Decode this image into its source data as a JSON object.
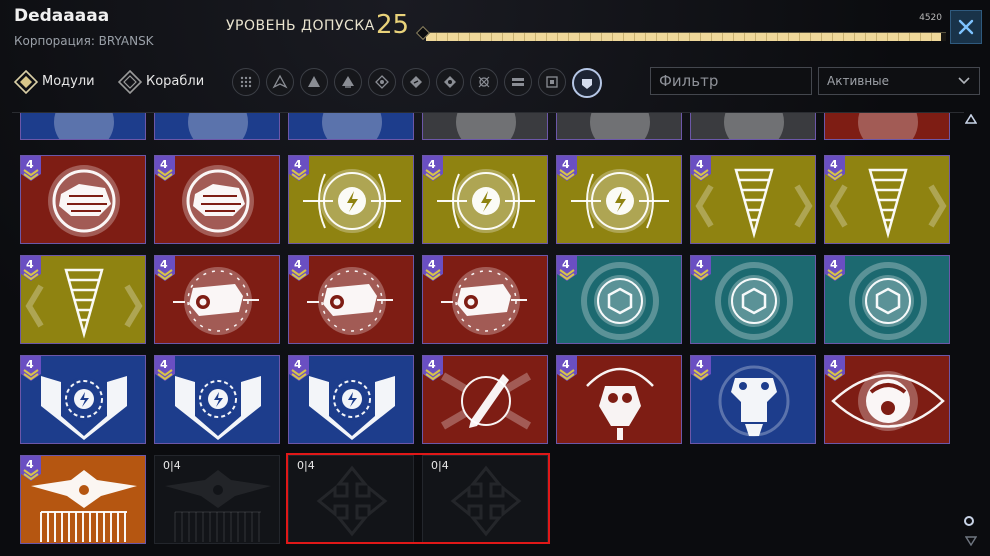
{
  "header": {
    "player_name": "Dedaaaaa",
    "corporation": "Корпорация: BRYANSK",
    "access_label": "УРОВЕНЬ ДОПУСКА",
    "access_level": "25",
    "progress_max": "4520",
    "progress_fraction": 0.99
  },
  "toolbar": {
    "tabs": [
      {
        "label": "Модули",
        "icon": "modules-diamond-icon",
        "active": true
      },
      {
        "label": "Корабли",
        "icon": "ships-diamond-icon",
        "active": false
      }
    ],
    "filter_icons": [
      "all-grid-icon",
      "interceptor-icon",
      "frigate-icon",
      "fighter-icon",
      "command-icon",
      "engineering-icon",
      "ecm-icon",
      "gunship-icon",
      "long-range-icon",
      "recon-icon",
      "destroyer-icon"
    ],
    "active_filter_index": 10,
    "filter_placeholder": "Фильтр",
    "status_selected": "Активные"
  },
  "colors": {
    "red": "#7e1d14",
    "yellow": "#8f8311",
    "teal": "#1c6970",
    "blue": "#1d3d8c",
    "orange": "#b55611",
    "badge": "#6a4fc2",
    "highlight": "#e01818",
    "progress": "#efd89a"
  },
  "grid": {
    "partial_row": [
      {
        "color": "blue",
        "icon": "module-icon"
      },
      {
        "color": "blue",
        "icon": "module-icon"
      },
      {
        "color": "blue",
        "icon": "module-icon"
      },
      {
        "color": "gray",
        "icon": "module-icon"
      },
      {
        "color": "gray",
        "icon": "module-icon"
      },
      {
        "color": "gray",
        "icon": "module-icon"
      },
      {
        "color": "red",
        "icon": "module-icon"
      }
    ],
    "rows": [
      [
        {
          "color": "red",
          "badge": "4",
          "icon": "armor-plate-icon"
        },
        {
          "color": "red",
          "badge": "4",
          "icon": "armor-plate-icon"
        },
        {
          "color": "yellow",
          "badge": "4",
          "icon": "energy-bolt-icon"
        },
        {
          "color": "yellow",
          "badge": "4",
          "icon": "energy-bolt-icon"
        },
        {
          "color": "yellow",
          "badge": "4",
          "icon": "energy-bolt-icon"
        },
        {
          "color": "yellow",
          "badge": "4",
          "icon": "vortex-cone-icon"
        },
        {
          "color": "yellow",
          "badge": "4",
          "icon": "vortex-cone-icon"
        }
      ],
      [
        {
          "color": "yellow",
          "badge": "4",
          "icon": "vortex-cone-icon"
        },
        {
          "color": "red",
          "badge": "4",
          "icon": "thruster-icon"
        },
        {
          "color": "red",
          "badge": "4",
          "icon": "thruster-icon"
        },
        {
          "color": "red",
          "badge": "4",
          "icon": "thruster-icon"
        },
        {
          "color": "teal",
          "badge": "4",
          "icon": "hexagon-shield-icon"
        },
        {
          "color": "teal",
          "badge": "4",
          "icon": "hexagon-shield-icon"
        },
        {
          "color": "teal",
          "badge": "4",
          "icon": "hexagon-shield-icon"
        }
      ],
      [
        {
          "color": "blue",
          "badge": "4",
          "icon": "reactor-shield-icon"
        },
        {
          "color": "blue",
          "badge": "4",
          "icon": "reactor-shield-icon"
        },
        {
          "color": "blue",
          "badge": "4",
          "icon": "reactor-shield-icon"
        },
        {
          "color": "red",
          "badge": "4",
          "icon": "missile-icon"
        },
        {
          "color": "red",
          "badge": "4",
          "icon": "drone-pod-icon"
        },
        {
          "color": "blue",
          "badge": "4",
          "icon": "mech-turret-icon"
        },
        {
          "color": "red",
          "badge": "4",
          "icon": "eye-sensor-icon"
        }
      ],
      [
        {
          "color": "orange",
          "badge": "4",
          "icon": "ship-blueprint-icon"
        },
        {
          "color": "empty",
          "count": "0|4",
          "icon": "ship-blueprint-icon"
        },
        {
          "color": "empty",
          "count": "0|4",
          "icon": "move-arrows-icon"
        },
        {
          "color": "empty",
          "count": "0|4",
          "icon": "move-arrows-icon"
        }
      ]
    ]
  }
}
